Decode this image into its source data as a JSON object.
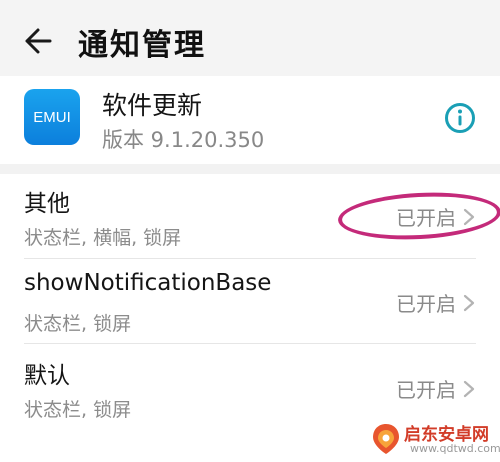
{
  "header": {
    "title": "通知管理"
  },
  "app": {
    "icon_text": "EMUI",
    "name": "软件更新",
    "version": "版本 9.1.20.350"
  },
  "channels": [
    {
      "title": "其他",
      "subtitle": "状态栏, 横幅, 锁屏",
      "status": "已开启"
    },
    {
      "title": "showNotificationBase",
      "subtitle": "状态栏, 锁屏",
      "status": "已开启"
    },
    {
      "title": "默认",
      "subtitle": "状态栏, 锁屏",
      "status": "已开启"
    }
  ],
  "watermark": {
    "cn": "启东安卓网",
    "en": "www.qdtwd.com"
  },
  "colors": {
    "accent": "#1a9fb5",
    "highlight": "#c42a7a",
    "app_icon": "#1390e8"
  }
}
